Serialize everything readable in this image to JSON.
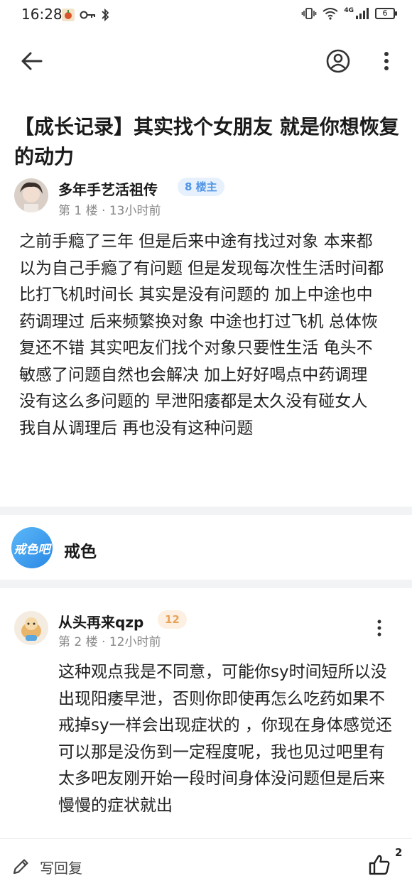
{
  "status_bar": {
    "time": "16:28",
    "network": "4G",
    "battery": "6"
  },
  "nav": {
    "back_icon": "arrow-left-icon",
    "profile_icon": "user-circle-icon",
    "more_icon": "vertical-dots-icon"
  },
  "post": {
    "title": "【成长记录】其实找个女朋友 就是你想恢复的动力",
    "author": {
      "name": "多年手艺活祖传",
      "badge": "8 楼主",
      "meta": "第 1 楼 · 13小时前"
    },
    "body": "之前手瘾了三年 但是后来中途有找过对象 本来都以为自己手瘾了有问题 但是发现每次性生活时间都比打飞机时间长 其实是没有问题的 加上中途也中药调理过 后来频繁换对象 中途也打过飞机 总体恢复还不错 其实吧友们找个对象只要性生活 龟头不敏感了问题自然也会解决 加上好好喝点中药调理 没有这么多问题的 早泄阳痿都是太久没有碰女人 我自从调理后 再也没有这种问题"
  },
  "forum": {
    "logo_text": "戒色吧",
    "name": "戒色"
  },
  "reply": {
    "author": {
      "name": "从头再来qzp",
      "badge": "12",
      "meta": "第 2 楼 · 12小时前"
    },
    "body": "这种观点我是不同意，可能你sy时间短所以没出现阳痿早泄，否则你即使再怎么吃药如果不戒掉sy一样会出现症状的 ，你现在身体感觉还可以那是没伤到一定程度呢，我也见过吧里有太多吧友刚开始一段时间身体没问题但是后来慢慢的症状就出"
  },
  "bottom_bar": {
    "reply_label": "写回复",
    "like_count": "2",
    "pencil_icon": "pencil-icon",
    "like_icon": "thumbs-up-icon"
  }
}
